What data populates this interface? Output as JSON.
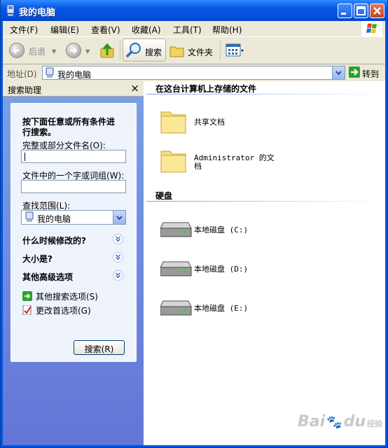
{
  "window": {
    "title": "我的电脑"
  },
  "menu": [
    "文件(F)",
    "编辑(E)",
    "查看(V)",
    "收藏(A)",
    "工具(T)",
    "帮助(H)"
  ],
  "toolbar": {
    "back": "后退",
    "search": "搜索",
    "folders": "文件夹"
  },
  "address": {
    "label": "地址(D)",
    "value": "我的电脑",
    "go": "转到"
  },
  "assistant": {
    "title": "搜索助理",
    "close": "×",
    "prompt_line1": "按下面任意或所有条件进",
    "prompt_line2": "行搜索。",
    "name_label": "完整或部分文件名(O):",
    "name_value": "",
    "word_label": "文件中的一个字或词组(W):",
    "word_value": "",
    "scope_label": "查找范围(L):",
    "scope_value": "我的电脑",
    "when_modified": "什么时候修改的?",
    "size": "大小是?",
    "advanced": "其他高级选项",
    "other_options": "其他搜索选项(S)",
    "change_prefs": "更改首选项(G)",
    "search_button": "搜索(R)"
  },
  "files_group": {
    "title": "在这台计算机上存储的文件",
    "items": [
      "共享文档",
      "Administrator 的文",
      "档"
    ]
  },
  "drives_group": {
    "title": "硬盘",
    "items": [
      "本地磁盘 (C:)",
      "本地磁盘 (D:)",
      "本地磁盘 (E:)"
    ]
  },
  "watermark": {
    "brand": "Bai",
    "du": "du",
    "suffix": "经验"
  },
  "colors": {
    "title_blue": "#0a55e4",
    "pane_blue": "#7aa1e6",
    "panel_bg": "#eef3fc"
  }
}
